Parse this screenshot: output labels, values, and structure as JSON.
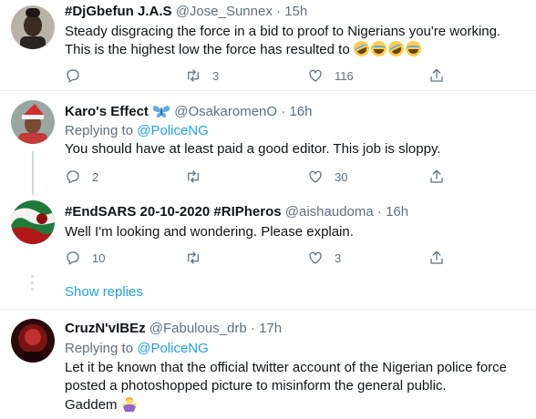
{
  "tweets": [
    {
      "name": "#DjGbefun J.A.S",
      "handle": "@Jose_Sunnex",
      "separator": "·",
      "time": "15h",
      "lines": [
        "Steady disgracing the force in a bid to proof to Nigerians you're working.",
        "This is the highest low the force has resulted to"
      ],
      "emojis": [
        "rolling-on-floor-laughing-emoji",
        "tears-of-joy-emoji",
        "rolling-on-floor-laughing-emoji",
        "tears-of-joy-emoji"
      ],
      "reply_count": "",
      "retweet_count": "3",
      "like_count": "116"
    },
    {
      "name": "Karo's Effect",
      "name_emoji": "butterfly-emoji",
      "handle": "@OsakaromenO",
      "separator": "·",
      "time": "16h",
      "replying_prefix": "Replying to",
      "replying_to": "@PoliceNG",
      "lines": [
        "You should have at least paid a good editor. This job is sloppy."
      ],
      "reply_count": "2",
      "retweet_count": "",
      "like_count": "30"
    },
    {
      "name": "#EndSARS 20-10-2020 #RIPheros",
      "handle": "@aishaudoma",
      "separator": "·",
      "time": "16h",
      "lines": [
        "Well I'm looking and wondering. Please explain."
      ],
      "reply_count": "10",
      "retweet_count": "",
      "like_count": "3"
    },
    {
      "name": "CruzN'vIBEz",
      "handle": "@Fabulous_drb",
      "separator": "·",
      "time": "17h",
      "replying_prefix": "Replying to",
      "replying_to": "@PoliceNG",
      "lines": [
        "Let it be known that the official twitter account of the Nigerian police force",
        "posted a photoshopped picture to misinform the general public.",
        "Gaddem"
      ],
      "end_emoji": "person-shrugging-emoji"
    }
  ],
  "show_replies": "Show replies",
  "colors": {
    "accent": "#1da1f2",
    "secondary_text": "#5b7083",
    "divider": "#ebeef0"
  }
}
